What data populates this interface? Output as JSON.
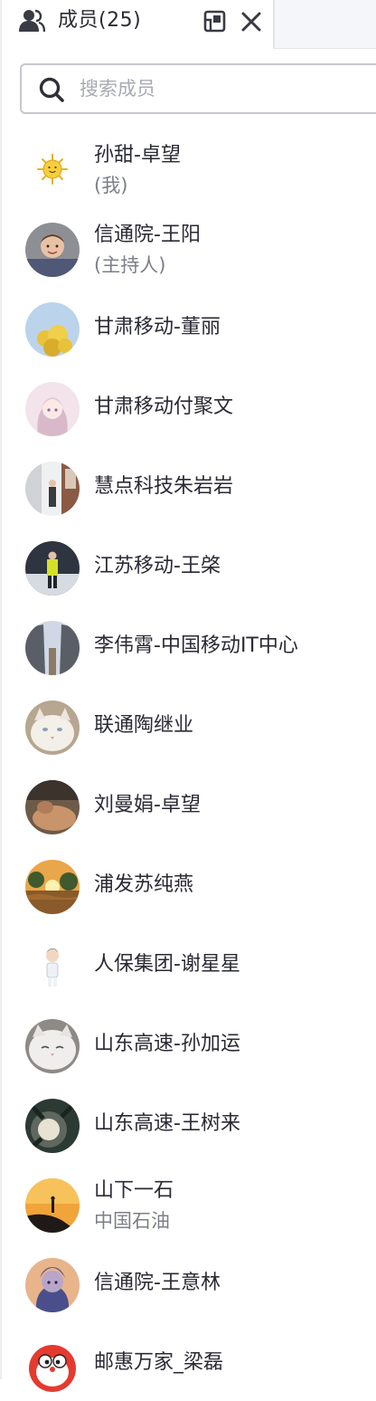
{
  "header": {
    "title": "成员(25)",
    "icons": {
      "people": "people-icon",
      "popout": "popout-icon",
      "close": "close-icon"
    }
  },
  "search": {
    "placeholder": "搜索成员",
    "value": ""
  },
  "members": [
    {
      "name": "孙甜-卓望",
      "sub": "(我)"
    },
    {
      "name": "信通院-王阳",
      "sub": "(主持人)"
    },
    {
      "name": "甘肃移动-董丽"
    },
    {
      "name": "甘肃移动付聚文"
    },
    {
      "name": "慧点科技朱岩岩"
    },
    {
      "name": "江苏移动-王棨"
    },
    {
      "name": "李伟霄-中国移动IT中心"
    },
    {
      "name": "联通陶继业"
    },
    {
      "name": "刘曼娟-卓望"
    },
    {
      "name": "浦发苏纯燕"
    },
    {
      "name": "人保集团-谢星星"
    },
    {
      "name": "山东高速-孙加运"
    },
    {
      "name": "山东高速-王树来"
    },
    {
      "name": "山下一石",
      "sub": "中国石油"
    },
    {
      "name": "信通院-王意林"
    },
    {
      "name": "邮惠万家_梁磊"
    }
  ],
  "colors": {
    "text": "#2a2a35",
    "subtext": "#7d7f88",
    "border": "#c6c8d0",
    "placeholder": "#a9abb3"
  }
}
